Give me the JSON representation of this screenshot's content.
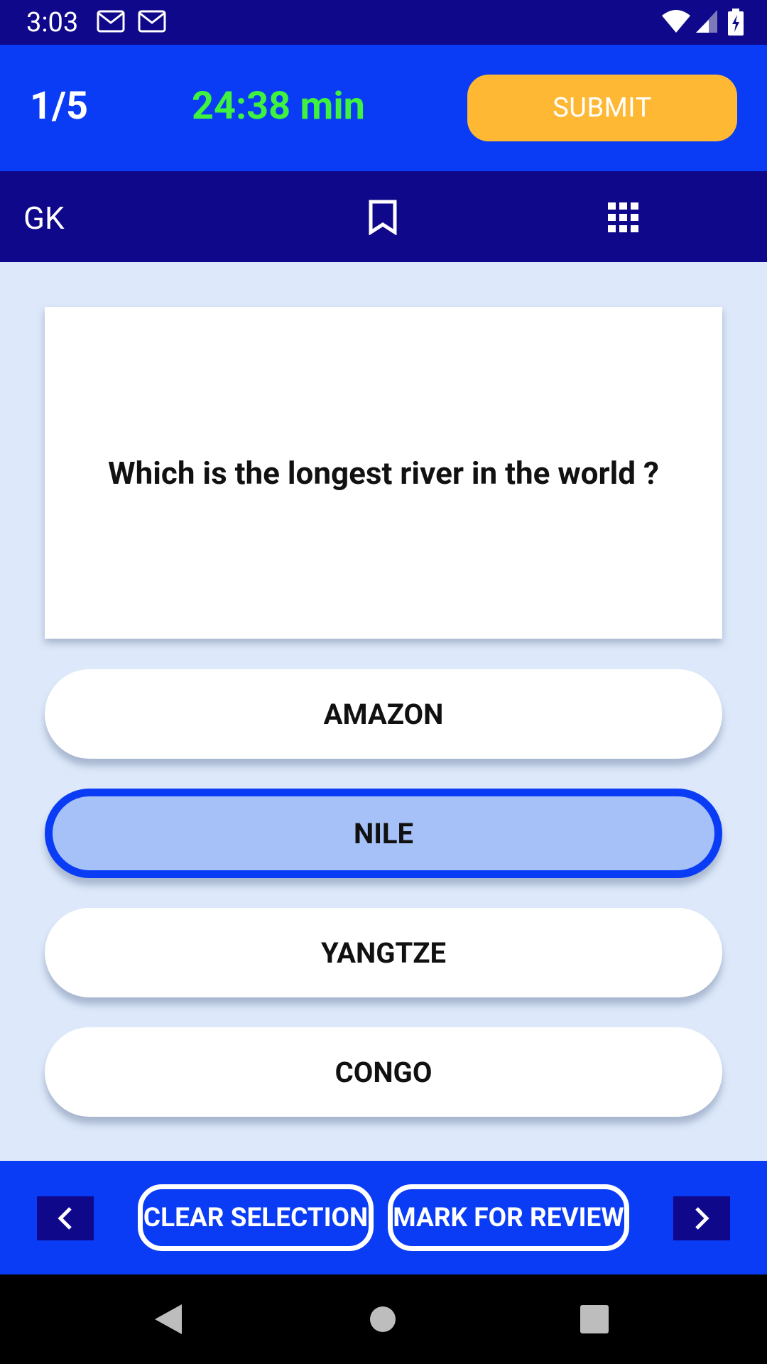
{
  "status_bar": {
    "time": "3:03",
    "icons": [
      "gmail-icon",
      "gmail-icon",
      "wifi-icon",
      "signal-icon",
      "battery-charging-icon"
    ]
  },
  "header": {
    "counter": "1/5",
    "timer": "24:38 min",
    "submit_label": "SUBMIT"
  },
  "toolbar": {
    "subject": "GK",
    "icons": [
      "bookmark-icon",
      "question-grid-icon"
    ]
  },
  "question": {
    "text": "Which is the longest river in the world ?"
  },
  "options": [
    {
      "label": "AMAZON",
      "selected": false
    },
    {
      "label": "NILE",
      "selected": true
    },
    {
      "label": "YANGTZE",
      "selected": false
    },
    {
      "label": "CONGO",
      "selected": false
    }
  ],
  "bottom": {
    "clear_label": "CLEAR SELECTION",
    "review_label": "MARK FOR REVIEW",
    "icons": [
      "chevron-left-icon",
      "chevron-right-icon"
    ]
  },
  "nav": {
    "icons": [
      "back-icon",
      "home-icon",
      "recents-icon"
    ]
  },
  "colors": {
    "primary": "#0a3cf5",
    "dark": "#10088a",
    "accent": "#ffb833",
    "timer": "#3ff23f",
    "selected_fill": "#a6c1f7",
    "background": "#dde9fa"
  }
}
